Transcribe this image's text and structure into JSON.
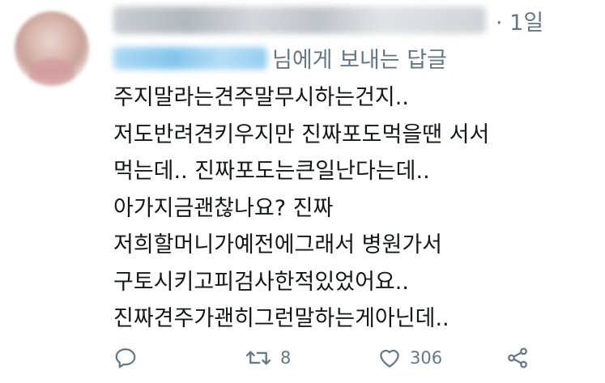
{
  "tweet": {
    "time_label": "· 1일",
    "reply_label": "님에게 보내는 답글",
    "lines": [
      "주지말라는견주말무시하는건지..",
      "저도반려견키우지만 진짜포도먹을땐 서서",
      "먹는데..  진짜포도는큰일난다는데..",
      "아가지금괜찮나요? 진짜",
      "저희할머니가예전에그래서 병원가서",
      "구토시키고피검사한적있었어요..",
      "진짜견주가괜히그런말하는게아닌데.."
    ]
  },
  "actions": {
    "reply_icon": "speech-bubble-icon",
    "retweet_icon": "retweet-icon",
    "retweet_count": "8",
    "like_icon": "heart-icon",
    "like_count": "306",
    "share_icon": "share-icon"
  },
  "colors": {
    "text": "#14171a",
    "muted": "#657786",
    "background": "#ffffff"
  }
}
